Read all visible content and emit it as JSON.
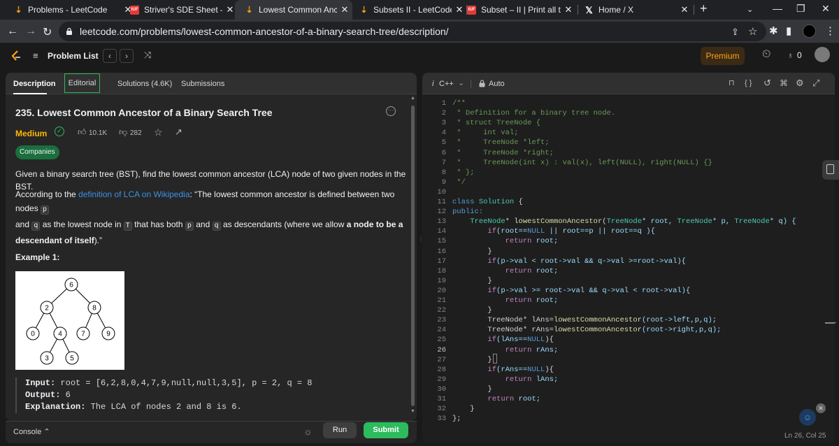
{
  "browser": {
    "tabs": [
      {
        "title": "Problems - LeetCode",
        "icon": "leetcode-icon",
        "active": false
      },
      {
        "title": "Striver's SDE Sheet – Top Co",
        "icon": "takeuforward-icon",
        "active": false
      },
      {
        "title": "Lowest Common Ancestor o",
        "icon": "leetcode-icon",
        "active": true
      },
      {
        "title": "Subsets II - LeetCode",
        "icon": "leetcode-icon",
        "active": false
      },
      {
        "title": "Subset – II | Print all the Un",
        "icon": "takeuforward-icon",
        "active": false
      },
      {
        "title": "Home / X",
        "icon": "x-icon",
        "active": false
      }
    ],
    "tuf_badge": "tUF",
    "x_glyph": "𝕏",
    "url": "leetcode.com/problems/lowest-common-ancestor-of-a-binary-search-tree/description/"
  },
  "nav": {
    "problem_list": "Problem List",
    "premium": "Premium",
    "streak": "0"
  },
  "description": {
    "tabs": [
      "Description",
      "Editorial",
      "Solutions (4.6K)",
      "Submissions"
    ],
    "title": "235. Lowest Common Ancestor of a Binary Search Tree",
    "difficulty": "Medium",
    "likes": "10.1K",
    "dislikes": "282",
    "companies": "Companies",
    "para1": "Given a binary search tree (BST), find the lowest common ancestor (LCA) node of two given nodes in the BST.",
    "p2": {
      "a": "According to the ",
      "link": "definition of LCA on Wikipedia",
      "b": ": “The lowest common ancestor is defined between two nodes ",
      "c1": "p",
      "d": "and ",
      "c2": "q",
      "e": " as the lowest node in ",
      "c3": "T",
      "f": " that has both ",
      "c4": "p",
      "g": " and ",
      "c5": "q",
      "h": " as descendants (where we allow ",
      "bold": "a node to be a descendant of itself",
      "end": ").”"
    },
    "example_title": "Example 1:",
    "tree_nodes": [
      "6",
      "2",
      "8",
      "0",
      "4",
      "7",
      "9",
      "3",
      "5"
    ],
    "ex_input_label": "Input:",
    "ex_input": " root = [6,2,8,0,4,7,9,null,null,3,5], p = 2, q = 8",
    "ex_output_label": "Output:",
    "ex_output": " 6",
    "ex_expl_label": "Explanation:",
    "ex_expl": " The LCA of nodes 2 and 8 is 6."
  },
  "console": {
    "label": "Console",
    "run": "Run",
    "submit": "Submit"
  },
  "editor": {
    "language": "C++",
    "auto": "Auto",
    "status": "Ln 26, Col 25",
    "lines": [
      [
        [
          "/**",
          "com"
        ]
      ],
      [
        [
          " * Definition for a binary tree node.",
          "com"
        ]
      ],
      [
        [
          " * struct TreeNode {",
          "com"
        ]
      ],
      [
        [
          " *     int val;",
          "com"
        ]
      ],
      [
        [
          " *     TreeNode *left;",
          "com"
        ]
      ],
      [
        [
          " *     TreeNode *right;",
          "com"
        ]
      ],
      [
        [
          " *     TreeNode(int x) : val(x), left(NULL), right(NULL) {}",
          "com"
        ]
      ],
      [
        [
          " * };",
          "com"
        ]
      ],
      [
        [
          " */",
          "com"
        ]
      ],
      [],
      [
        [
          "class ",
          "kw"
        ],
        [
          "Solution",
          "type"
        ],
        [
          " {",
          "plain"
        ]
      ],
      [
        [
          "public:",
          "kw"
        ]
      ],
      [
        [
          "    ",
          "plain"
        ],
        [
          "TreeNode",
          "type"
        ],
        [
          "* ",
          "plain"
        ],
        [
          "lowestCommonAncestor",
          "fn"
        ],
        [
          "(",
          "plain"
        ],
        [
          "TreeNode",
          "type"
        ],
        [
          "* root, ",
          "var"
        ],
        [
          "TreeNode",
          "type"
        ],
        [
          "* p, ",
          "var"
        ],
        [
          "TreeNode",
          "type"
        ],
        [
          "* q) {",
          "var"
        ]
      ],
      [
        [
          "        ",
          "plain"
        ],
        [
          "if",
          "ctl"
        ],
        [
          "(root==",
          "var"
        ],
        [
          "NULL",
          "kw"
        ],
        [
          " || root==p || root==q ){",
          "var"
        ]
      ],
      [
        [
          "            ",
          "plain"
        ],
        [
          "return",
          "ctl"
        ],
        [
          " root;",
          "var"
        ]
      ],
      [
        [
          "        }",
          "plain"
        ]
      ],
      [
        [
          "        ",
          "plain"
        ],
        [
          "if",
          "ctl"
        ],
        [
          "(p->val < root->val && q->val >=root->val){",
          "var"
        ]
      ],
      [
        [
          "            ",
          "plain"
        ],
        [
          "return",
          "ctl"
        ],
        [
          " root;",
          "var"
        ]
      ],
      [
        [
          "        }",
          "plain"
        ]
      ],
      [
        [
          "        ",
          "plain"
        ],
        [
          "if",
          "ctl"
        ],
        [
          "(p->val >= root->val && q->val < root->val){",
          "var"
        ]
      ],
      [
        [
          "            ",
          "plain"
        ],
        [
          "return",
          "ctl"
        ],
        [
          " root;",
          "var"
        ]
      ],
      [
        [
          "        }",
          "plain"
        ]
      ],
      [
        [
          "        TreeNode* lAns=",
          "plain"
        ],
        [
          "lowestCommonAncestor",
          "fn"
        ],
        [
          "(root->left,p,q);",
          "var"
        ]
      ],
      [
        [
          "        TreeNode* rAns=",
          "plain"
        ],
        [
          "lowestCommonAncestor",
          "fn"
        ],
        [
          "(root->right,p,q);",
          "var"
        ]
      ],
      [
        [
          "        ",
          "plain"
        ],
        [
          "if",
          "ctl"
        ],
        [
          "(lAns==",
          "var"
        ],
        [
          "NULL",
          "kw"
        ],
        [
          "){",
          "plain"
        ]
      ],
      [
        [
          "            ",
          "plain"
        ],
        [
          "return",
          "ctl"
        ],
        [
          " rAns;",
          "var"
        ]
      ],
      [
        [
          "        }",
          "plain"
        ]
      ],
      [
        [
          "        ",
          "plain"
        ],
        [
          "if",
          "ctl"
        ],
        [
          "(rAns==",
          "var"
        ],
        [
          "NULL",
          "kw"
        ],
        [
          "){",
          "plain"
        ]
      ],
      [
        [
          "            ",
          "plain"
        ],
        [
          "return",
          "ctl"
        ],
        [
          " lAns;",
          "var"
        ]
      ],
      [
        [
          "        }",
          "plain"
        ]
      ],
      [
        [
          "        ",
          "plain"
        ],
        [
          "return",
          "ctl"
        ],
        [
          " root;",
          "var"
        ]
      ],
      [
        [
          "    }",
          "plain"
        ]
      ],
      [
        [
          "};",
          "plain"
        ]
      ]
    ]
  }
}
